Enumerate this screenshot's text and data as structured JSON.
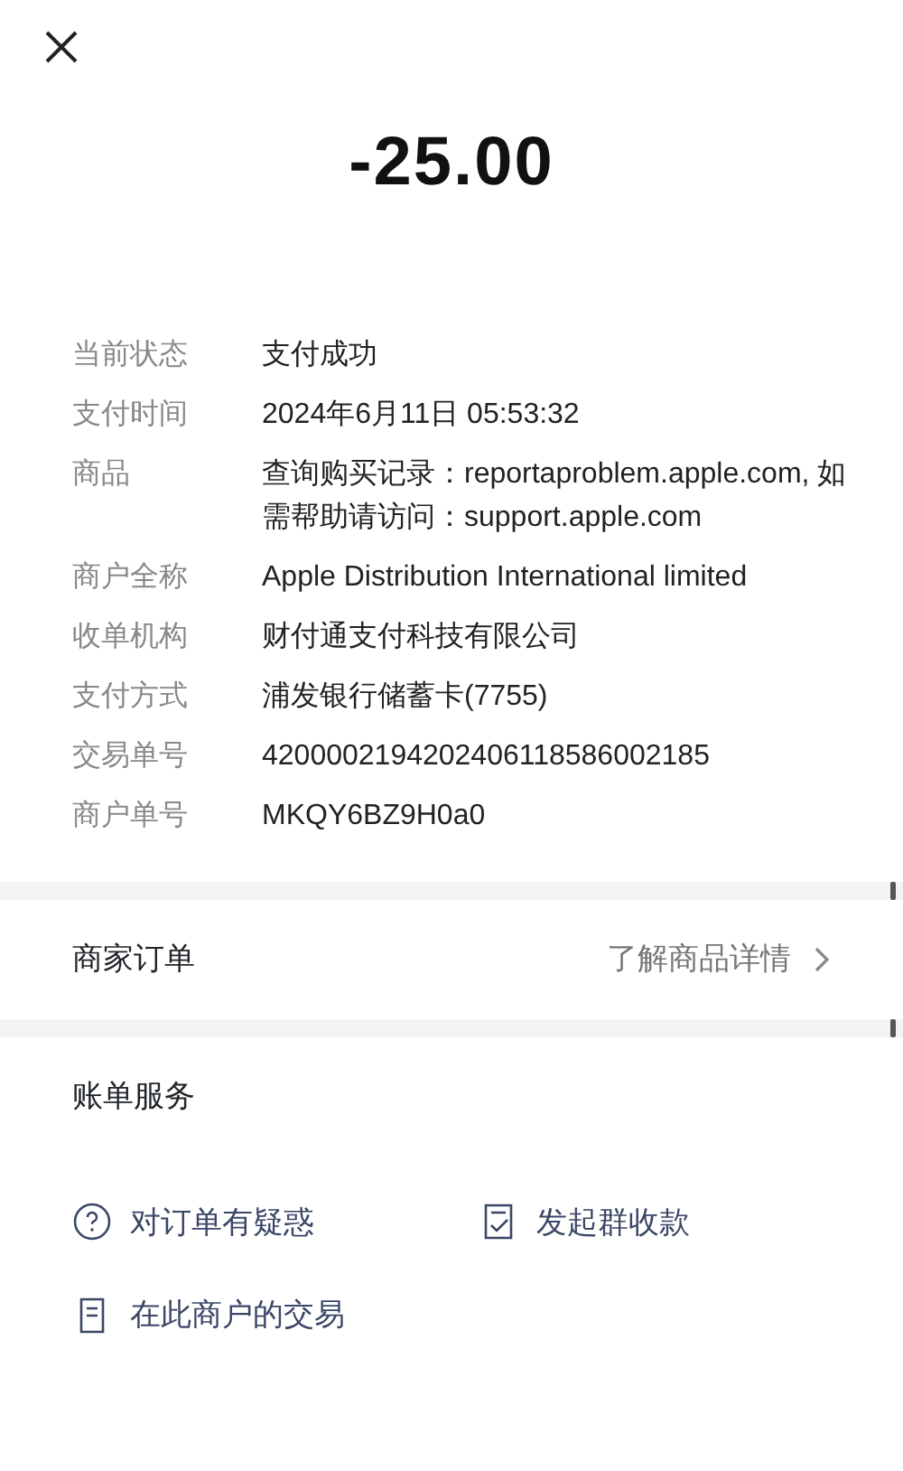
{
  "amount": "-25.00",
  "details": [
    {
      "label": "当前状态",
      "value": "支付成功"
    },
    {
      "label": "支付时间",
      "value": "2024年6月11日 05:53:32"
    },
    {
      "label": "商品",
      "value": "查询购买记录：reportaproblem.apple.com, 如需帮助请访问：support.apple.com"
    },
    {
      "label": "商户全称",
      "value": "Apple Distribution International limited"
    },
    {
      "label": "收单机构",
      "value": "财付通支付科技有限公司"
    },
    {
      "label": "支付方式",
      "value": "浦发银行储蓄卡(7755)"
    },
    {
      "label": "交易单号",
      "value": "4200002194202406118586002185"
    },
    {
      "label": "商户单号",
      "value": "MKQY6BZ9H0a0"
    }
  ],
  "merchant_order": {
    "title": "商家订单",
    "link": "了解商品详情"
  },
  "bill_services": {
    "title": "账单服务",
    "actions": [
      {
        "kind": "question",
        "label": "对订单有疑惑"
      },
      {
        "kind": "split",
        "label": "发起群收款"
      },
      {
        "kind": "list",
        "label": "在此商户的交易"
      }
    ]
  }
}
